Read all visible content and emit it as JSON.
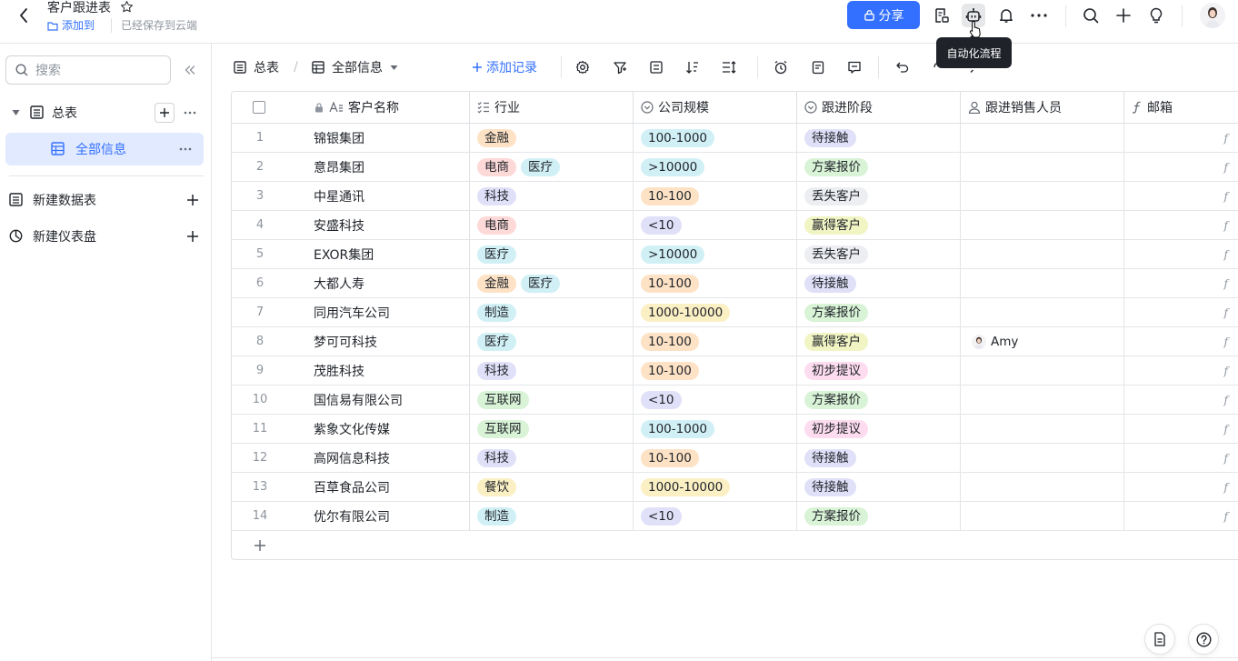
{
  "header": {
    "title": "客户跟进表",
    "add_to": "添加到",
    "saved": "已经保存到云端",
    "share": "分享",
    "tooltip": "自动化流程"
  },
  "sidebar": {
    "search_placeholder": "搜索",
    "items": [
      {
        "label": "总表"
      },
      {
        "label": "全部信息"
      },
      {
        "label": "新建数据表"
      },
      {
        "label": "新建仪表盘"
      }
    ]
  },
  "toolbar": {
    "view_table": "总表",
    "view_current": "全部信息",
    "add_record": "添加记录"
  },
  "table": {
    "columns": [
      "客户名称",
      "行业",
      "公司规模",
      "跟进阶段",
      "跟进销售人员",
      "邮箱"
    ],
    "rows": [
      {
        "n": "1",
        "name": "锦银集团",
        "industry": [
          "金融"
        ],
        "size": "100-1000",
        "stage": "待接触",
        "sales": ""
      },
      {
        "n": "2",
        "name": "意昂集团",
        "industry": [
          "电商",
          "医疗"
        ],
        "size": ">10000",
        "stage": "方案报价",
        "sales": ""
      },
      {
        "n": "3",
        "name": "中星通讯",
        "industry": [
          "科技"
        ],
        "size": "10-100",
        "stage": "丢失客户",
        "sales": ""
      },
      {
        "n": "4",
        "name": "安盛科技",
        "industry": [
          "电商"
        ],
        "size": "<10",
        "stage": "赢得客户",
        "sales": ""
      },
      {
        "n": "5",
        "name": "EXOR集团",
        "industry": [
          "医疗"
        ],
        "size": ">10000",
        "stage": "丢失客户",
        "sales": ""
      },
      {
        "n": "6",
        "name": "大都人寿",
        "industry": [
          "金融",
          "医疗"
        ],
        "size": "10-100",
        "stage": "待接触",
        "sales": ""
      },
      {
        "n": "7",
        "name": "同用汽车公司",
        "industry": [
          "制造"
        ],
        "size": "1000-10000",
        "stage": "方案报价",
        "sales": ""
      },
      {
        "n": "8",
        "name": "梦可可科技",
        "industry": [
          "医疗"
        ],
        "size": "10-100",
        "stage": "赢得客户",
        "sales": "Amy"
      },
      {
        "n": "9",
        "name": "茂胜科技",
        "industry": [
          "科技"
        ],
        "size": "10-100",
        "stage": "初步提议",
        "sales": ""
      },
      {
        "n": "10",
        "name": "国信易有限公司",
        "industry": [
          "互联网"
        ],
        "size": "<10",
        "stage": "方案报价",
        "sales": ""
      },
      {
        "n": "11",
        "name": "紫象文化传媒",
        "industry": [
          "互联网"
        ],
        "size": "100-1000",
        "stage": "初步提议",
        "sales": ""
      },
      {
        "n": "12",
        "name": "高网信息科技",
        "industry": [
          "科技"
        ],
        "size": "10-100",
        "stage": "待接触",
        "sales": ""
      },
      {
        "n": "13",
        "name": "百草食品公司",
        "industry": [
          "餐饮"
        ],
        "size": "1000-10000",
        "stage": "待接触",
        "sales": ""
      },
      {
        "n": "14",
        "name": "优尔有限公司",
        "industry": [
          "制造"
        ],
        "size": "<10",
        "stage": "方案报价",
        "sales": ""
      }
    ]
  },
  "colors": {
    "accent": "#3370ff",
    "industry": {
      "金融": "#fde2c5",
      "电商": "#fdd9d8",
      "医疗": "#d1f0f6",
      "科技": "#e0e0f8",
      "制造": "#d1f0f6",
      "互联网": "#d9f3d6",
      "餐饮": "#fbefc4"
    },
    "size": {
      "100-1000": "#d1f0f6",
      ">10000": "#d1f0f6",
      "10-100": "#fde2c5",
      "<10": "#e0e0f8",
      "1000-10000": "#fbefc4"
    },
    "stage": {
      "待接触": "#e0e0f8",
      "方案报价": "#d9f3d6",
      "丢失客户": "#eceef1",
      "赢得客户": "#f1f5c4",
      "初步提议": "#fcdcee"
    }
  }
}
